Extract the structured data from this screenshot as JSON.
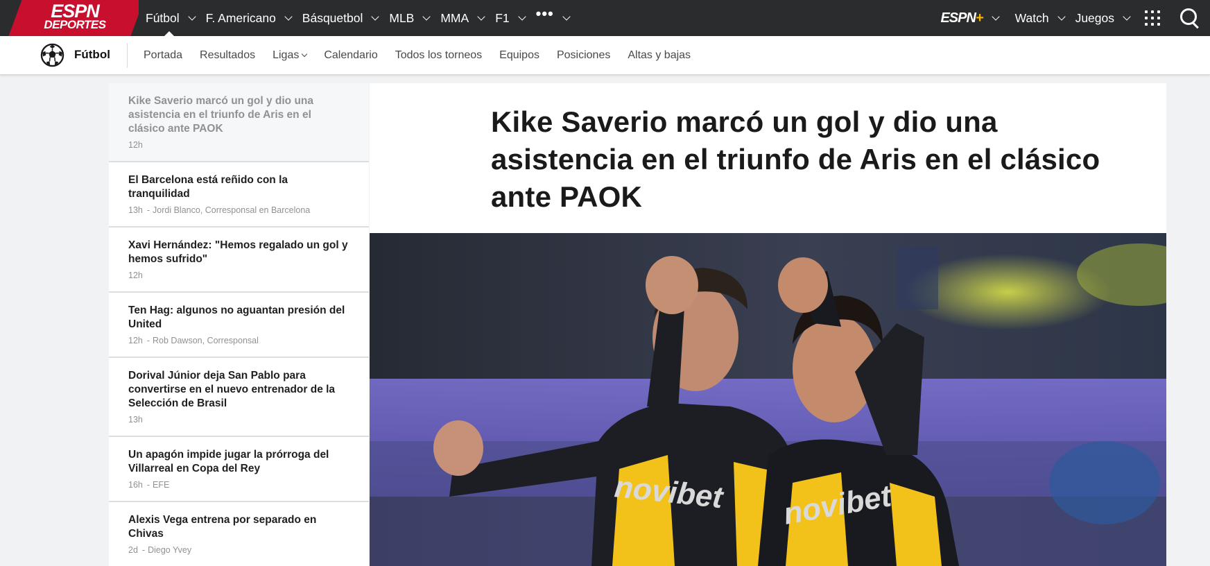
{
  "header": {
    "logo": {
      "line1": "ESPN",
      "line2": "DEPORTES"
    },
    "nav_items": [
      {
        "label": "Fútbol",
        "active": true
      },
      {
        "label": "F. Americano"
      },
      {
        "label": "Básquetbol"
      },
      {
        "label": "MLB"
      },
      {
        "label": "MMA"
      },
      {
        "label": "F1"
      },
      {
        "label": "•••"
      }
    ],
    "espn_plus": {
      "text": "ESPN",
      "plus": "+"
    },
    "right_items": [
      {
        "label": "Watch"
      },
      {
        "label": "Juegos"
      }
    ],
    "icons": [
      "chevron-down-icon",
      "apps-grid-icon",
      "search-icon"
    ]
  },
  "subnav": {
    "sport": "Fútbol",
    "icon": "soccer-ball-icon",
    "links": [
      {
        "label": "Portada"
      },
      {
        "label": "Resultados"
      },
      {
        "label": "Ligas",
        "dropdown": true
      },
      {
        "label": "Calendario"
      },
      {
        "label": "Todos los torneos"
      },
      {
        "label": "Equipos"
      },
      {
        "label": "Posiciones"
      },
      {
        "label": "Altas y bajas"
      }
    ]
  },
  "sidebar": {
    "stories": [
      {
        "title": "Kike Saverio marcó un gol y dio una asistencia en el triunfo de Aris en el clásico ante PAOK",
        "time": "12h",
        "byline": ""
      },
      {
        "title": "El Barcelona está reñido con la tranquilidad",
        "time": "13h",
        "byline": "Jordi Blanco, Corresponsal en Barcelona"
      },
      {
        "title": "Xavi Hernández: \"Hemos regalado un gol y hemos sufrido\"",
        "time": "12h",
        "byline": ""
      },
      {
        "title": "Ten Hag: algunos no aguantan presión del United",
        "time": "12h",
        "byline": "Rob Dawson, Corresponsal"
      },
      {
        "title": "Dorival Júnior deja San Pablo para convertirse en el nuevo entrenador de la Selección de Brasil",
        "time": "13h",
        "byline": ""
      },
      {
        "title": "Un apagón impide jugar la prórroga del Villarreal en Copa del Rey",
        "time": "16h",
        "byline": "EFE"
      },
      {
        "title": "Alexis Vega entrena por separado en Chivas",
        "time": "2d",
        "byline": "Diego Yvey"
      }
    ]
  },
  "article": {
    "headline": "Kike Saverio marcó un gol y dio una asistencia en el triunfo de Aris en el clásico ante PAOK",
    "hero_jersey_text_1": "novibet",
    "hero_jersey_text_2": "novibet"
  },
  "colors": {
    "topbar": "#2b2c2d",
    "brand_red": "#c8102e",
    "espn_plus_gold": "#f3b400",
    "jersey_yellow": "#f2c21b"
  }
}
